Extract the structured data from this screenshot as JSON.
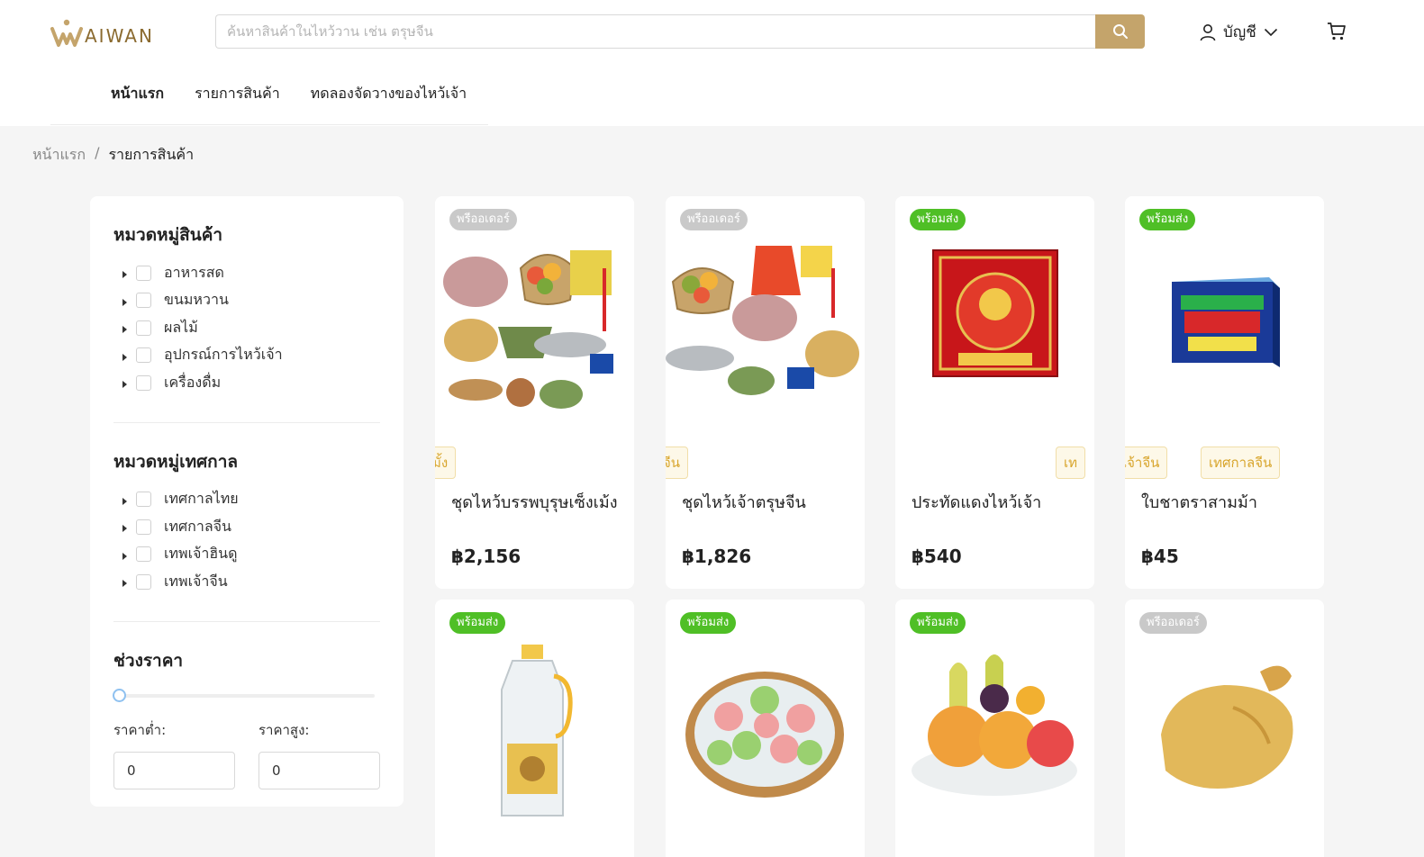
{
  "brand": {
    "name": "AIWAN"
  },
  "search": {
    "placeholder": "ค้นหาสินค้าในไหว้วาน เช่น ตรุษจีน",
    "value": ""
  },
  "account": {
    "label": "บัญชี"
  },
  "nav": [
    {
      "label": "หน้าแรก"
    },
    {
      "label": "รายการสินค้า"
    },
    {
      "label": "ทดลองจัดวางของไหว้เจ้า"
    }
  ],
  "breadcrumb": {
    "home": "หน้าแรก",
    "separator": "/",
    "current": "รายการสินค้า"
  },
  "filters": {
    "product_categories": {
      "title": "หมวดหมู่สินค้า",
      "items": [
        "อาหารสด",
        "ขนมหวาน",
        "ผลไม้",
        "อุปกรณ์การไหว้เจ้า",
        "เครื่องดื่ม"
      ]
    },
    "festival_categories": {
      "title": "หมวดหมู่เทศกาล",
      "items": [
        "เทศกาลไทย",
        "เทศกาลจีน",
        "เทพเจ้าฮินดู",
        "เทพเจ้าจีน"
      ]
    },
    "price": {
      "title": "ช่วงราคา",
      "min_label": "ราคาต่ำ:",
      "max_label": "ราคาสูง:",
      "min_value": "0",
      "max_value": "0"
    }
  },
  "products": [
    {
      "badge": "พรีออเดอร์",
      "badge_type": "preorder",
      "tags": [
        "มั้ง"
      ],
      "name": "ชุดไหว้บรรพบุรุษเซ็งเม้ง",
      "price": "฿2,156",
      "image": "offering-set-icon"
    },
    {
      "badge": "พรีออเดอร์",
      "badge_type": "preorder",
      "tags": [
        "จีน"
      ],
      "name": "ชุดไหว้เจ้าตรุษจีน",
      "price": "฿1,826",
      "image": "chinese-new-year-set-icon"
    },
    {
      "badge": "พร้อมส่ง",
      "badge_type": "ready",
      "tags": [
        "เท"
      ],
      "name": "ประทัดแดงไหว้เจ้า",
      "price": "฿540",
      "image": "firecracker-box-icon"
    },
    {
      "badge": "พร้อมส่ง",
      "badge_type": "ready",
      "tags": [
        "เจ้าจีน",
        "เทศกาลจีน"
      ],
      "name": "ใบชาตราสามม้า",
      "price": "฿45",
      "image": "tea-box-icon"
    },
    {
      "badge": "พร้อมส่ง",
      "badge_type": "ready",
      "tags": [],
      "name": "",
      "price": "",
      "image": "oil-bottle-icon"
    },
    {
      "badge": "พร้อมส่ง",
      "badge_type": "ready",
      "tags": [],
      "name": "",
      "price": "",
      "image": "steamed-cake-icon"
    },
    {
      "badge": "พร้อมส่ง",
      "badge_type": "ready",
      "tags": [],
      "name": "",
      "price": "",
      "image": "fruit-plate-icon"
    },
    {
      "badge": "พรีออเดอร์",
      "badge_type": "preorder",
      "tags": [],
      "name": "",
      "price": "",
      "image": "boiled-chicken-icon"
    }
  ],
  "colors": {
    "accent": "#c4a46b",
    "ready_badge": "#4fbf26",
    "preorder_badge": "#c9c9c9",
    "tag_text": "#d8a52c"
  }
}
